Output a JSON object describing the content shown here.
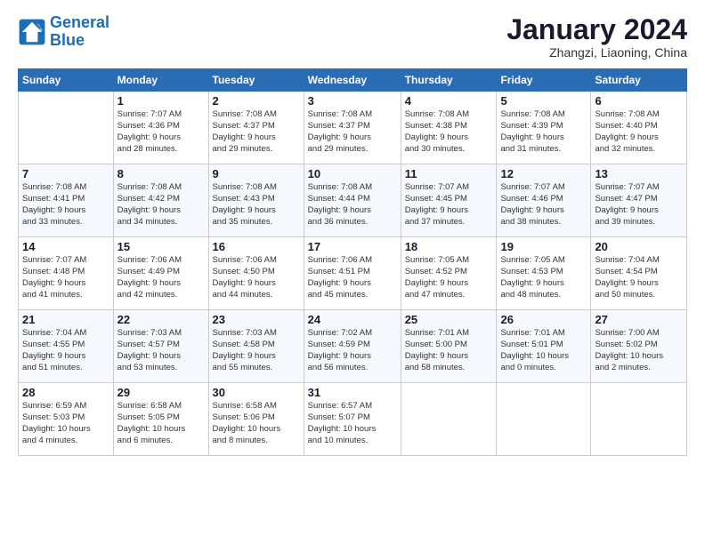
{
  "header": {
    "logo_general": "General",
    "logo_blue": "Blue",
    "main_title": "January 2024",
    "subtitle": "Zhangzi, Liaoning, China"
  },
  "days_of_week": [
    "Sunday",
    "Monday",
    "Tuesday",
    "Wednesday",
    "Thursday",
    "Friday",
    "Saturday"
  ],
  "weeks": [
    [
      {
        "day": "",
        "info": ""
      },
      {
        "day": "1",
        "info": "Sunrise: 7:07 AM\nSunset: 4:36 PM\nDaylight: 9 hours\nand 28 minutes."
      },
      {
        "day": "2",
        "info": "Sunrise: 7:08 AM\nSunset: 4:37 PM\nDaylight: 9 hours\nand 29 minutes."
      },
      {
        "day": "3",
        "info": "Sunrise: 7:08 AM\nSunset: 4:37 PM\nDaylight: 9 hours\nand 29 minutes."
      },
      {
        "day": "4",
        "info": "Sunrise: 7:08 AM\nSunset: 4:38 PM\nDaylight: 9 hours\nand 30 minutes."
      },
      {
        "day": "5",
        "info": "Sunrise: 7:08 AM\nSunset: 4:39 PM\nDaylight: 9 hours\nand 31 minutes."
      },
      {
        "day": "6",
        "info": "Sunrise: 7:08 AM\nSunset: 4:40 PM\nDaylight: 9 hours\nand 32 minutes."
      }
    ],
    [
      {
        "day": "7",
        "info": "Sunrise: 7:08 AM\nSunset: 4:41 PM\nDaylight: 9 hours\nand 33 minutes."
      },
      {
        "day": "8",
        "info": "Sunrise: 7:08 AM\nSunset: 4:42 PM\nDaylight: 9 hours\nand 34 minutes."
      },
      {
        "day": "9",
        "info": "Sunrise: 7:08 AM\nSunset: 4:43 PM\nDaylight: 9 hours\nand 35 minutes."
      },
      {
        "day": "10",
        "info": "Sunrise: 7:08 AM\nSunset: 4:44 PM\nDaylight: 9 hours\nand 36 minutes."
      },
      {
        "day": "11",
        "info": "Sunrise: 7:07 AM\nSunset: 4:45 PM\nDaylight: 9 hours\nand 37 minutes."
      },
      {
        "day": "12",
        "info": "Sunrise: 7:07 AM\nSunset: 4:46 PM\nDaylight: 9 hours\nand 38 minutes."
      },
      {
        "day": "13",
        "info": "Sunrise: 7:07 AM\nSunset: 4:47 PM\nDaylight: 9 hours\nand 39 minutes."
      }
    ],
    [
      {
        "day": "14",
        "info": "Sunrise: 7:07 AM\nSunset: 4:48 PM\nDaylight: 9 hours\nand 41 minutes."
      },
      {
        "day": "15",
        "info": "Sunrise: 7:06 AM\nSunset: 4:49 PM\nDaylight: 9 hours\nand 42 minutes."
      },
      {
        "day": "16",
        "info": "Sunrise: 7:06 AM\nSunset: 4:50 PM\nDaylight: 9 hours\nand 44 minutes."
      },
      {
        "day": "17",
        "info": "Sunrise: 7:06 AM\nSunset: 4:51 PM\nDaylight: 9 hours\nand 45 minutes."
      },
      {
        "day": "18",
        "info": "Sunrise: 7:05 AM\nSunset: 4:52 PM\nDaylight: 9 hours\nand 47 minutes."
      },
      {
        "day": "19",
        "info": "Sunrise: 7:05 AM\nSunset: 4:53 PM\nDaylight: 9 hours\nand 48 minutes."
      },
      {
        "day": "20",
        "info": "Sunrise: 7:04 AM\nSunset: 4:54 PM\nDaylight: 9 hours\nand 50 minutes."
      }
    ],
    [
      {
        "day": "21",
        "info": "Sunrise: 7:04 AM\nSunset: 4:55 PM\nDaylight: 9 hours\nand 51 minutes."
      },
      {
        "day": "22",
        "info": "Sunrise: 7:03 AM\nSunset: 4:57 PM\nDaylight: 9 hours\nand 53 minutes."
      },
      {
        "day": "23",
        "info": "Sunrise: 7:03 AM\nSunset: 4:58 PM\nDaylight: 9 hours\nand 55 minutes."
      },
      {
        "day": "24",
        "info": "Sunrise: 7:02 AM\nSunset: 4:59 PM\nDaylight: 9 hours\nand 56 minutes."
      },
      {
        "day": "25",
        "info": "Sunrise: 7:01 AM\nSunset: 5:00 PM\nDaylight: 9 hours\nand 58 minutes."
      },
      {
        "day": "26",
        "info": "Sunrise: 7:01 AM\nSunset: 5:01 PM\nDaylight: 10 hours\nand 0 minutes."
      },
      {
        "day": "27",
        "info": "Sunrise: 7:00 AM\nSunset: 5:02 PM\nDaylight: 10 hours\nand 2 minutes."
      }
    ],
    [
      {
        "day": "28",
        "info": "Sunrise: 6:59 AM\nSunset: 5:03 PM\nDaylight: 10 hours\nand 4 minutes."
      },
      {
        "day": "29",
        "info": "Sunrise: 6:58 AM\nSunset: 5:05 PM\nDaylight: 10 hours\nand 6 minutes."
      },
      {
        "day": "30",
        "info": "Sunrise: 6:58 AM\nSunset: 5:06 PM\nDaylight: 10 hours\nand 8 minutes."
      },
      {
        "day": "31",
        "info": "Sunrise: 6:57 AM\nSunset: 5:07 PM\nDaylight: 10 hours\nand 10 minutes."
      },
      {
        "day": "",
        "info": ""
      },
      {
        "day": "",
        "info": ""
      },
      {
        "day": "",
        "info": ""
      }
    ]
  ]
}
